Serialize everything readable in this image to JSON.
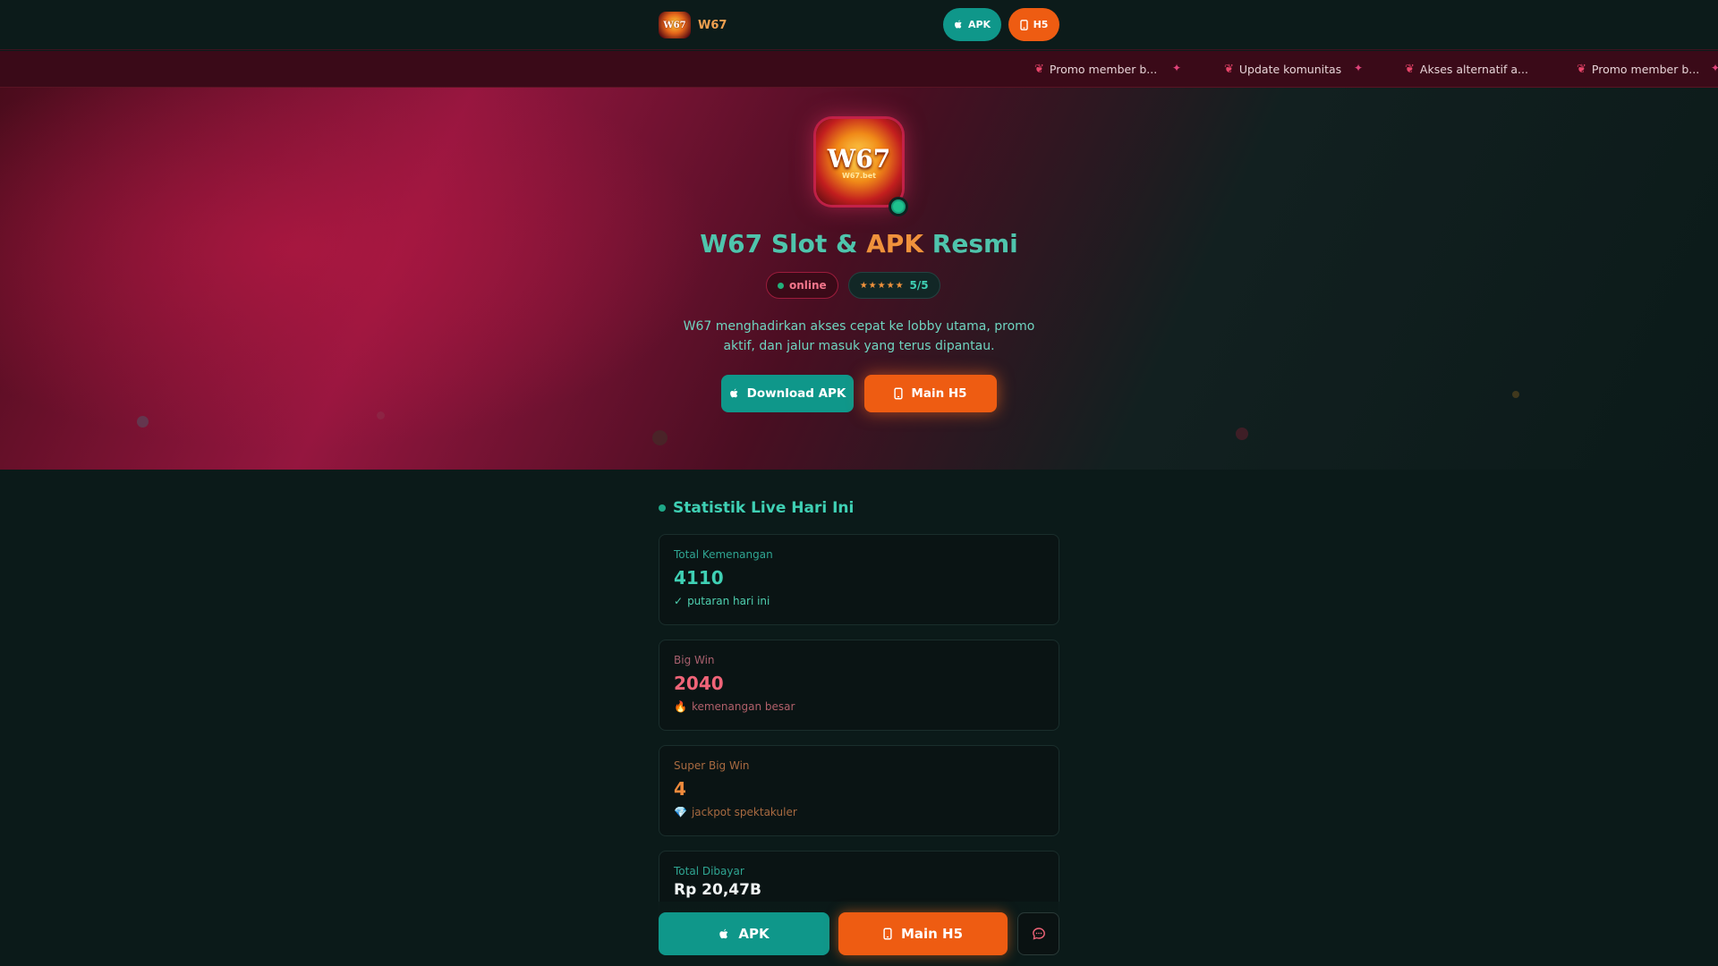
{
  "header": {
    "logo_text": "W67",
    "brand_name": "W67",
    "apk_label": "APK",
    "h5_label": "H5"
  },
  "ticker": {
    "items": [
      "Promo member b...",
      "Update komunitas",
      "Akses alternatif a...",
      "Promo member b..."
    ]
  },
  "hero": {
    "logo_text": "W67",
    "logo_sub": "W67.bet",
    "title_part1": "W67 Slot & ",
    "title_part2": "APK",
    "title_part3": " Resmi",
    "status_label": "online",
    "stars": "★★★★★",
    "rating": "5/5",
    "description": "W67 menghadirkan akses cepat ke lobby utama, promo aktif, dan jalur masuk yang terus dipantau.",
    "download_label": "Download APK",
    "play_label": "Main H5"
  },
  "stats": {
    "heading": "Statistik Live Hari Ini",
    "cards": [
      {
        "label": "Total Kemenangan",
        "value": "4110",
        "sub_icon": "✓",
        "sub": "putaran hari ini"
      },
      {
        "label": "Big Win",
        "value": "2040",
        "sub_icon": "🔥",
        "sub": "kemenangan besar"
      },
      {
        "label": "Super Big Win",
        "value": "4",
        "sub_icon": "💎",
        "sub": "jackpot spektakuler"
      },
      {
        "label": "Total Dibayar",
        "value": "Rp 20,47B"
      }
    ]
  },
  "bottom_bar": {
    "apk_label": "APK",
    "h5_label": "Main H5"
  },
  "colors": {
    "teal": "#0f978a",
    "orange": "#ee5c12",
    "crimson": "#95163f",
    "background": "#0b1a19"
  }
}
